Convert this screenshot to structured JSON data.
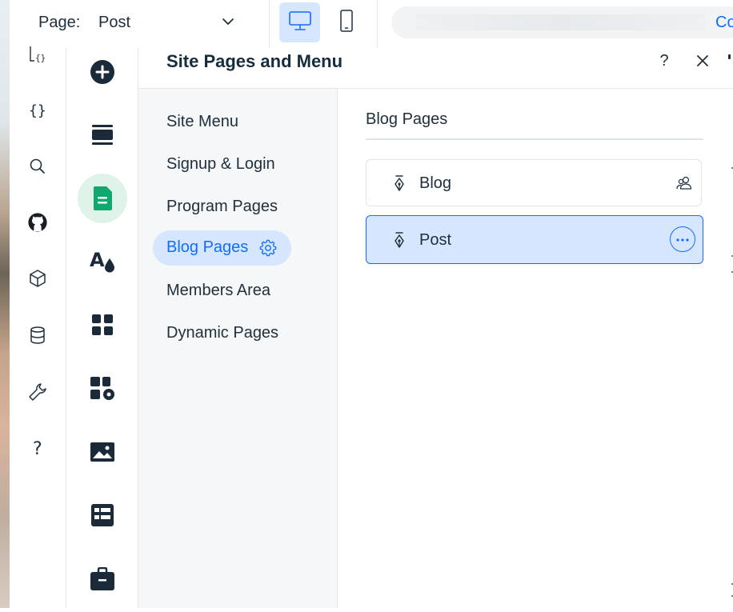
{
  "topbar": {
    "page_label": "Page:",
    "page_value": "Post",
    "cta_text": "Co"
  },
  "panel": {
    "title": "Site Pages and Menu",
    "help_glyph": "?",
    "menu": {
      "items": [
        {
          "label": "Site Menu"
        },
        {
          "label": "Signup & Login"
        },
        {
          "label": "Program Pages"
        },
        {
          "label": "Blog Pages",
          "active": true
        },
        {
          "label": "Members Area"
        },
        {
          "label": "Dynamic Pages"
        }
      ]
    },
    "section": {
      "title": "Blog Pages",
      "rows": [
        {
          "label": "Blog",
          "icon": "pen-nib-icon",
          "trailing_icon": "members-icon"
        },
        {
          "label": "Post",
          "icon": "pen-nib-icon",
          "trailing_icon": "more-actions-icon",
          "selected": true
        }
      ]
    }
  },
  "colors": {
    "accent": "#116dff",
    "accent_light": "#d6e6fe",
    "pages_green": "#0fa86e",
    "pages_green_light": "#dff3ea",
    "text_dark": "#20303c"
  }
}
